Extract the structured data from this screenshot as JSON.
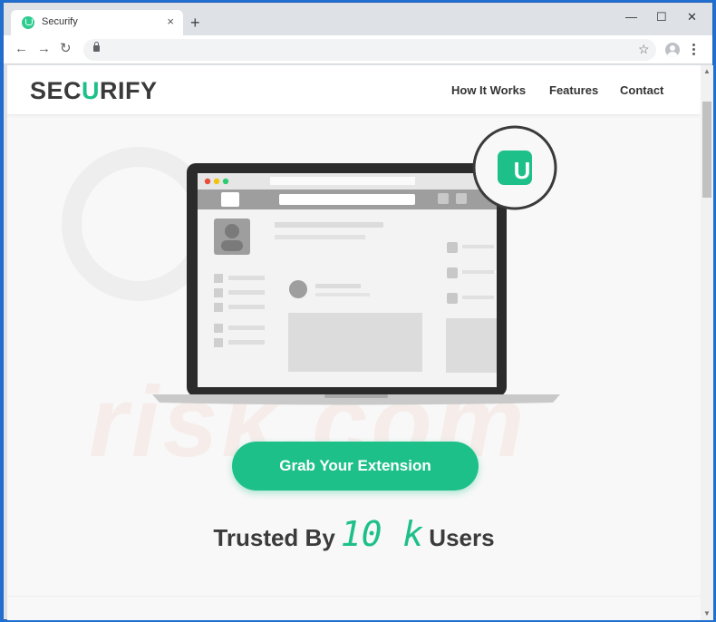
{
  "browser": {
    "tab_title": "Securify",
    "tab_close": "×",
    "new_tab": "+",
    "controls": {
      "minimize": "—",
      "maximize": "☐",
      "close": "✕"
    },
    "nav": {
      "back": "←",
      "forward": "→",
      "reload": "↻"
    },
    "star": "☆"
  },
  "site": {
    "logo_pre": "SEC",
    "logo_u": "U",
    "logo_post": "RIFY",
    "nav": [
      "How It Works",
      "Features",
      "Contact"
    ],
    "badge_letter": "U",
    "cta": "Grab Your Extension",
    "trusted_pre": "Trusted By",
    "trusted_count": "10 k",
    "trusted_post": "Users"
  },
  "colors": {
    "brand": "#1ec08a",
    "text": "#3b3b3b"
  }
}
